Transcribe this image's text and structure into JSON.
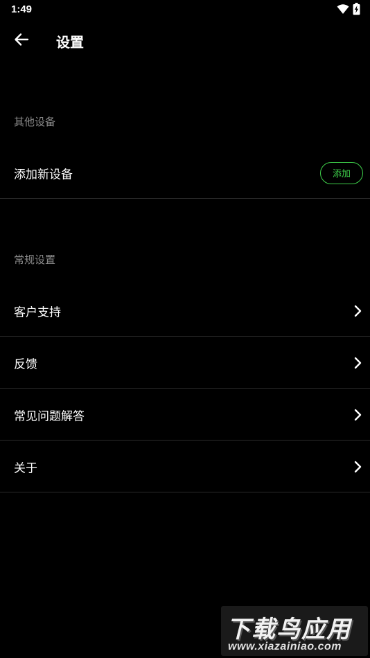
{
  "status_bar": {
    "time": "1:49",
    "icons": [
      "wifi-icon",
      "battery-charging-icon"
    ]
  },
  "app_bar": {
    "back_icon": "arrow-left-icon",
    "title": "设置"
  },
  "sections": {
    "other_devices": {
      "header": "其他设备",
      "add_device_label": "添加新设备",
      "add_button_label": "添加"
    },
    "general": {
      "header": "常规设置",
      "items": [
        {
          "label": "客户支持",
          "icon": "chevron-right-icon"
        },
        {
          "label": "反馈",
          "icon": "chevron-right-icon"
        },
        {
          "label": "常见问题解答",
          "icon": "chevron-right-icon"
        },
        {
          "label": "关于",
          "icon": "chevron-right-icon"
        }
      ]
    }
  },
  "watermark": {
    "main": "下载鸟应用",
    "sub": "www.xiazainiao.com"
  },
  "colors": {
    "background": "#000000",
    "accent": "#3ecf4a",
    "section_header": "#8a8a8a",
    "divider": "#2a2a2a",
    "text": "#ffffff"
  }
}
